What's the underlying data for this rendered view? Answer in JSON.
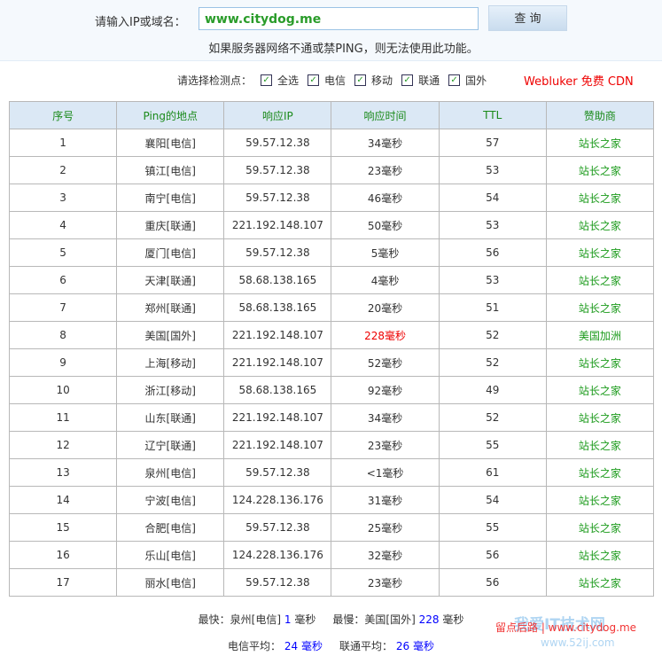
{
  "form": {
    "label": "请输入IP或域名：",
    "value": "www.citydog.me",
    "button": "查 询",
    "note": "如果服务器网络不通或禁PING，则无法使用此功能。"
  },
  "select": {
    "label": "请选择检测点：",
    "options": [
      "全选",
      "电信",
      "移动",
      "联通",
      "国外"
    ],
    "check": "✓"
  },
  "cdn": "Webluker 免费 CDN",
  "headers": [
    "序号",
    "Ping的地点",
    "响应IP",
    "响应时间",
    "TTL",
    "赞助商"
  ],
  "rows": [
    [
      "1",
      "襄阳[电信]",
      "59.57.12.38",
      "34毫秒",
      "57",
      "站长之家"
    ],
    [
      "2",
      "镇江[电信]",
      "59.57.12.38",
      "23毫秒",
      "53",
      "站长之家"
    ],
    [
      "3",
      "南宁[电信]",
      "59.57.12.38",
      "46毫秒",
      "54",
      "站长之家"
    ],
    [
      "4",
      "重庆[联通]",
      "221.192.148.107",
      "50毫秒",
      "53",
      "站长之家"
    ],
    [
      "5",
      "厦门[电信]",
      "59.57.12.38",
      "5毫秒",
      "56",
      "站长之家"
    ],
    [
      "6",
      "天津[联通]",
      "58.68.138.165",
      "4毫秒",
      "53",
      "站长之家"
    ],
    [
      "7",
      "郑州[联通]",
      "58.68.138.165",
      "20毫秒",
      "51",
      "站长之家"
    ],
    [
      "8",
      "美国[国外]",
      "221.192.148.107",
      "228毫秒",
      "52",
      "美国加洲"
    ],
    [
      "9",
      "上海[移动]",
      "221.192.148.107",
      "52毫秒",
      "52",
      "站长之家"
    ],
    [
      "10",
      "浙江[移动]",
      "58.68.138.165",
      "92毫秒",
      "49",
      "站长之家"
    ],
    [
      "11",
      "山东[联通]",
      "221.192.148.107",
      "34毫秒",
      "52",
      "站长之家"
    ],
    [
      "12",
      "辽宁[联通]",
      "221.192.148.107",
      "23毫秒",
      "55",
      "站长之家"
    ],
    [
      "13",
      "泉州[电信]",
      "59.57.12.38",
      "<1毫秒",
      "61",
      "站长之家"
    ],
    [
      "14",
      "宁波[电信]",
      "124.228.136.176",
      "31毫秒",
      "54",
      "站长之家"
    ],
    [
      "15",
      "合肥[电信]",
      "59.57.12.38",
      "25毫秒",
      "55",
      "站长之家"
    ],
    [
      "16",
      "乐山[电信]",
      "124.228.136.176",
      "32毫秒",
      "56",
      "站长之家"
    ],
    [
      "17",
      "丽水[电信]",
      "59.57.12.38",
      "23毫秒",
      "56",
      "站长之家"
    ]
  ],
  "highlight_row": 8,
  "summary": {
    "fast_label": "最快：泉州[电信]",
    "fast_val": "1",
    "fast_unit": "毫秒",
    "slow_label": "最慢：美国[国外]",
    "slow_val": "228",
    "slow_unit": "毫秒",
    "tel_label": "电信平均：",
    "tel_val": "24 毫秒",
    "uni_label": "联通平均：",
    "uni_val": "26 毫秒"
  },
  "watermark": {
    "title": "我爱IT技术网",
    "url": "www.52ij.com",
    "slogan": "留点后路 | www.citydog.me"
  }
}
